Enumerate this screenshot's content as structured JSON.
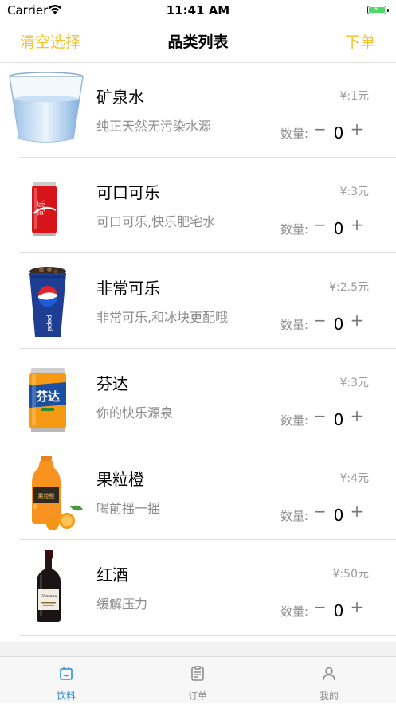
{
  "status_bar": {
    "carrier": "Carrier",
    "time": "11:41 AM"
  },
  "nav": {
    "left": "清空选择",
    "title": "品类列表",
    "right": "下单"
  },
  "qty_label": "数量:",
  "minus_symbol": "−",
  "plus_symbol": "+",
  "products": [
    {
      "name": "矿泉水",
      "desc": "纯正天然无污染水源",
      "price": "¥:1元",
      "qty": "0",
      "icon": "water-glass-icon"
    },
    {
      "name": "可口可乐",
      "desc": "可口可乐,快乐肥宅水",
      "price": "¥:3元",
      "qty": "0",
      "icon": "coca-cola-can-icon"
    },
    {
      "name": "非常可乐",
      "desc": "非常可乐,和冰块更配哦",
      "price": "¥:2.5元",
      "qty": "0",
      "icon": "pepsi-cup-icon"
    },
    {
      "name": "芬达",
      "desc": "你的快乐源泉",
      "price": "¥:3元",
      "qty": "0",
      "icon": "fanta-can-icon"
    },
    {
      "name": "果粒橙",
      "desc": "喝前摇一摇",
      "price": "¥:4元",
      "qty": "0",
      "icon": "orange-juice-bottle-icon"
    },
    {
      "name": "红酒",
      "desc": "缓解压力",
      "price": "¥:50元",
      "qty": "0",
      "icon": "red-wine-bottle-icon"
    }
  ],
  "tabs": [
    {
      "label": "饮料",
      "active": true,
      "icon": "drinks-tab-icon"
    },
    {
      "label": "订单",
      "active": false,
      "icon": "orders-tab-icon"
    },
    {
      "label": "我的",
      "active": false,
      "icon": "profile-tab-icon"
    }
  ],
  "colors": {
    "accent": "#f2c12e",
    "tab_active": "#2f8fd8",
    "battery": "#4cd964"
  }
}
